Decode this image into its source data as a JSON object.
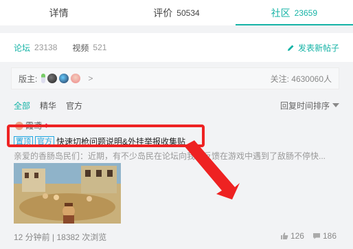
{
  "tabs": [
    {
      "label": "详情",
      "count": ""
    },
    {
      "label": "评价",
      "count": "50534"
    },
    {
      "label": "社区",
      "count": "23659"
    }
  ],
  "subnav": {
    "forum_label": "论坛",
    "forum_count": "23138",
    "video_label": "视频",
    "video_count": "521",
    "post_button": "发表新帖子"
  },
  "moderators": {
    "label": "版主:",
    "more": ">",
    "followers": "关注: 4630060人"
  },
  "filters": {
    "items": [
      "全部",
      "精华",
      "官方"
    ],
    "sort": "回复时间排序"
  },
  "post": {
    "author": "霞鸢",
    "badges": [
      "置顶",
      "官方"
    ],
    "title": "快速切枪问题说明&外挂举报收集贴",
    "excerpt": "亲爱的香肠岛民们：近期，有不少岛民在论坛向我们反馈在游戏中遇到了敌肠不停快...",
    "time": "12 分钟前",
    "views": "18382 次浏览",
    "likes": "126",
    "comments": "186"
  },
  "colors": {
    "accent": "#15b3a6",
    "badge": "#1ea5e0",
    "annotation": "#ee2222"
  }
}
